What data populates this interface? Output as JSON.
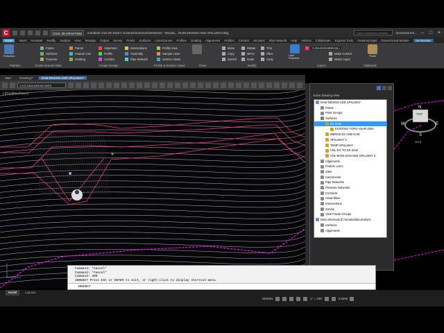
{
  "app": {
    "workspace": "CIVIL 3D DRAFTING",
    "title": "Autodesk Civil 3D 2018   C:\\Users\\mmorrison\\OneDrive - Wooda... \\DAM DESIGN-ADD SPILLWAY.dwg",
    "search_placeholder": "Type a keyword or phrase",
    "user": "mmorrisonAh..."
  },
  "ribbon": {
    "tabs": [
      "Home",
      "Insert",
      "Annotate",
      "Modify",
      "Analyze",
      "View",
      "Manage",
      "Output",
      "Survey",
      "Points",
      "Surfaces",
      "Lines/Curves",
      "Profiles",
      "Grading",
      "Alignments",
      "Profiles",
      "Corridor",
      "Sections",
      "Pipe Network",
      "Help",
      "Add-ins",
      "Collaborate",
      "Express Tools",
      "Featured Apps",
      "Geotechnical Module",
      "Geolocation"
    ],
    "active_tab": "Home",
    "toolspace": "Toolspace",
    "col1": [
      "Points",
      "Surfaces",
      "Traverse"
    ],
    "col2": [
      "Parcel",
      "Feature Line",
      "Grading"
    ],
    "col3": [
      "Alignment",
      "Profile",
      "Corridor"
    ],
    "col4": [
      "Intersections",
      "Assembly",
      "Pipe Network"
    ],
    "col5": [
      "Profile View",
      "Sample Lines",
      "Section Views"
    ],
    "col6": [
      "Move",
      "Copy",
      "Stretch"
    ],
    "col7": [
      "Rotate",
      "Mirror",
      "Scale"
    ],
    "col8": [
      "Trim",
      "Fillet",
      "Array"
    ],
    "layer_properties": "Layer Properties",
    "layer_dropdown": "C-ES-DAM-BREAKLI",
    "layer_col": [
      "Make Current",
      "Match Layer"
    ],
    "paste": "Paste",
    "groups": [
      "Palettes",
      "Create Ground Data",
      "Create Design",
      "Profile & Section Views",
      "Draw",
      "Modify",
      "Layers",
      "Clipboard"
    ]
  },
  "file_tabs": [
    "Start",
    "Drawing1*",
    "DAM DESIGN-ADD SPILLWAY*"
  ],
  "active_file_tab": "DAM DESIGN-ADD SPILLWAY*",
  "toolbar2": {
    "layer": "C-ES-DAM-BREAKLINES"
  },
  "viewport": {
    "label": "[-][Top][Wireframe]"
  },
  "viewcube": {
    "top": "TOP",
    "n": "N",
    "s": "S",
    "e": "E",
    "w": "W",
    "wcs": "WCS"
  },
  "prospector": {
    "header": "Active Drawing View",
    "items": [
      {
        "label": "DAM DESIGN-ADD SPILLWAY",
        "indent": 0,
        "icon": "#6a8fd0"
      },
      {
        "label": "Points",
        "indent": 1,
        "icon": "#888"
      },
      {
        "label": "Point Groups",
        "indent": 1,
        "icon": "#888"
      },
      {
        "label": "Surfaces",
        "indent": 1,
        "icon": "#5a8c5a"
      },
      {
        "label": "ES DAM",
        "indent": 2,
        "icon": "#d4a017",
        "selected": true
      },
      {
        "label": "EXISTING TOPO-YEAR 2004",
        "indent": 3,
        "icon": "#d4a017"
      },
      {
        "label": "MERGE ES AND DAM",
        "indent": 2,
        "icon": "#d4a017"
      },
      {
        "label": "SPILLWAY 3",
        "indent": 2,
        "icon": "#d4a017"
      },
      {
        "label": "TEMP-SPILLWAY",
        "indent": 2,
        "icon": "#d4a017"
      },
      {
        "label": "VOL-EG TO ES DAM",
        "indent": 2,
        "icon": "#d4a017"
      },
      {
        "label": "VOL-MAIN DAM AND SPILLWAY 3",
        "indent": 2,
        "icon": "#d4a017"
      },
      {
        "label": "Alignments",
        "indent": 1,
        "icon": "#888"
      },
      {
        "label": "Feature Lines",
        "indent": 1,
        "icon": "#888"
      },
      {
        "label": "Sites",
        "indent": 1,
        "icon": "#888"
      },
      {
        "label": "Catchments",
        "indent": 1,
        "icon": "#888"
      },
      {
        "label": "Pipe Networks",
        "indent": 1,
        "icon": "#888"
      },
      {
        "label": "Pressure Networks",
        "indent": 1,
        "icon": "#888"
      },
      {
        "label": "Corridors",
        "indent": 1,
        "icon": "#888"
      },
      {
        "label": "Assemblies",
        "indent": 1,
        "icon": "#888"
      },
      {
        "label": "Intersections",
        "indent": 1,
        "icon": "#888"
      },
      {
        "label": "Survey",
        "indent": 1,
        "icon": "#888"
      },
      {
        "label": "View Frame Groups",
        "indent": 1,
        "icon": "#888"
      },
      {
        "label": "Data Shortcuts [C:\\woodard&curran\\ph...",
        "indent": 0,
        "icon": "#6a8fd0"
      },
      {
        "label": "Surfaces",
        "indent": 1,
        "icon": "#888"
      },
      {
        "label": "Alignments",
        "indent": 1,
        "icon": "#888"
      }
    ]
  },
  "command": {
    "history": [
      "Command: *Cancel*",
      "Command: *Cancel*",
      "Command: 300",
      "300EBIT Press ESC or ENTER to exit, or right-click to display shortcut-menu."
    ],
    "input": "300EBIT"
  },
  "status": {
    "model_tab": "Model",
    "layout_tab": "Layout1",
    "model": "MODEL",
    "scale": "1\" = 100'",
    "zoom": "3.5000"
  },
  "colors": {
    "accent": "#4a90c2",
    "contour": "#c0c0c0",
    "dam": "#ff3b7f",
    "magenta": "#ff00ff"
  }
}
